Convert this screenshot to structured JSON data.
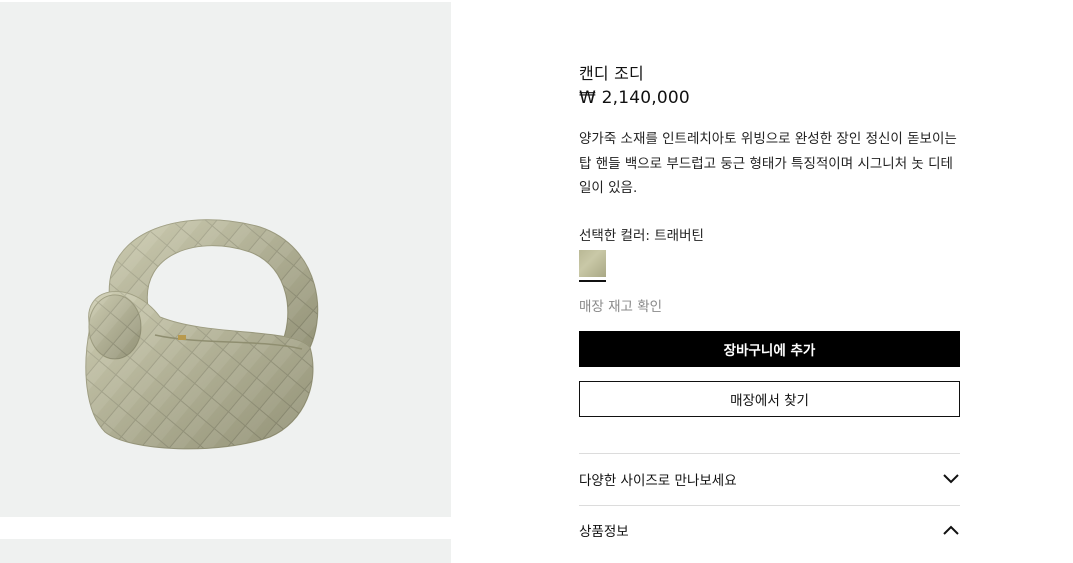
{
  "product": {
    "name": "캔디 조디",
    "price": "₩ 2,140,000",
    "description": "양가죽 소재를 인트레치아토 위빙으로 완성한 장인 정신이 돋보이는 탑 핸들 백으로 부드럽고 둥근 형태가 특징적이며 시그니처 놋 디테일이 있음."
  },
  "color": {
    "selected_label": "선택한 컬러: 트래버틴",
    "swatch_color": "#c1c09d"
  },
  "links": {
    "store_stock": "매장 재고 확인"
  },
  "buttons": {
    "add_to_cart": "장바구니에 추가",
    "find_in_store": "매장에서 찾기"
  },
  "accordion": [
    {
      "label": "다양한 사이즈로 만나보세요",
      "icon": "chevron-down-icon"
    },
    {
      "label": "상품정보",
      "icon": "chevron-up-icon"
    }
  ],
  "colors": {
    "image_bg": "#eff1f0",
    "primary_button_bg": "#000000",
    "muted_text": "#8a8a8a",
    "bag_color": "#c4c3a2"
  }
}
